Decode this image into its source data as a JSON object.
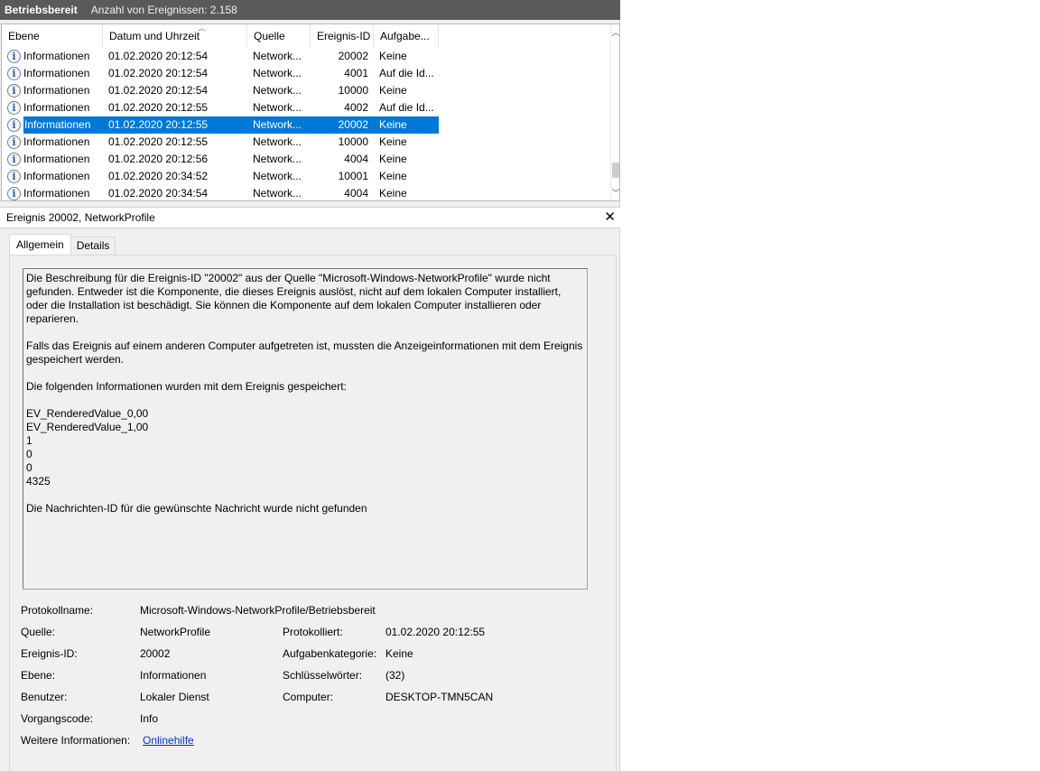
{
  "titlebar": {
    "title": "Betriebsbereit",
    "count": "Anzahl von Ereignissen: 2.158"
  },
  "columns": [
    "Ebene",
    "Datum und Uhrzeit",
    "Quelle",
    "Ereignis-ID",
    "Aufgabe..."
  ],
  "rows": [
    [
      "Informationen",
      "01.02.2020 20:12:54",
      "Network...",
      "20002",
      "Keine"
    ],
    [
      "Informationen",
      "01.02.2020 20:12:54",
      "Network...",
      "4001",
      "Auf die Id..."
    ],
    [
      "Informationen",
      "01.02.2020 20:12:54",
      "Network...",
      "10000",
      "Keine"
    ],
    [
      "Informationen",
      "01.02.2020 20:12:55",
      "Network...",
      "4002",
      "Auf die Id..."
    ],
    [
      "Informationen",
      "01.02.2020 20:12:55",
      "Network...",
      "20002",
      "Keine"
    ],
    [
      "Informationen",
      "01.02.2020 20:12:55",
      "Network...",
      "10000",
      "Keine"
    ],
    [
      "Informationen",
      "01.02.2020 20:12:56",
      "Network...",
      "4004",
      "Keine"
    ],
    [
      "Informationen",
      "01.02.2020 20:34:52",
      "Network...",
      "10001",
      "Keine"
    ],
    [
      "Informationen",
      "01.02.2020 20:34:54",
      "Network...",
      "4004",
      "Keine"
    ]
  ],
  "selected_row": 4,
  "detail": {
    "header": "Ereignis 20002, NetworkProfile",
    "close_label": "✕",
    "tabs": [
      "Allgemein",
      "Details"
    ],
    "description": "Die Beschreibung für die Ereignis-ID \"20002\" aus der Quelle \"Microsoft-Windows-NetworkProfile\" wurde nicht gefunden. Entweder ist die Komponente, die dieses Ereignis auslöst, nicht auf dem lokalen Computer installiert, oder die Installation ist beschädigt. Sie können die Komponente auf dem lokalen Computer installieren oder reparieren.\n\nFalls das Ereignis auf einem anderen Computer aufgetreten ist, mussten die Anzeigeinformationen mit dem Ereignis gespeichert werden.\n\nDie folgenden Informationen wurden mit dem Ereignis gespeichert:\n\nEV_RenderedValue_0,00\nEV_RenderedValue_1,00\n1\n0\n0\n4325\n\nDie Nachrichten-ID für die gewünschte Nachricht wurde nicht gefunden",
    "props": {
      "protokollname_label": "Protokollname:",
      "protokollname": "Microsoft-Windows-NetworkProfile/Betriebsbereit",
      "quelle_label": "Quelle:",
      "quelle": "NetworkProfile",
      "protokolliert_label": "Protokolliert:",
      "protokolliert": "01.02.2020 20:12:55",
      "ereignis_id_label": "Ereignis-ID:",
      "ereignis_id": "20002",
      "aufgabenkategorie_label": "Aufgabenkategorie:",
      "aufgabenkategorie": "Keine",
      "ebene_label": "Ebene:",
      "ebene": "Informationen",
      "schluesselwoerter_label": "Schlüsselwörter:",
      "schluesselwoerter": "(32)",
      "benutzer_label": "Benutzer:",
      "benutzer": "Lokaler Dienst",
      "computer_label": "Computer:",
      "computer": "DESKTOP-TMN5CAN",
      "vorgangscode_label": "Vorgangscode:",
      "vorgangscode": "Info",
      "weitere_label": "Weitere Informationen:",
      "weitere_link": "Onlinehilfe"
    }
  },
  "icons": {
    "row_icon": "info-icon",
    "sort": "sort-up-icon",
    "scroll_up": "scroll-up-icon",
    "scroll_down": "scroll-down-icon"
  }
}
